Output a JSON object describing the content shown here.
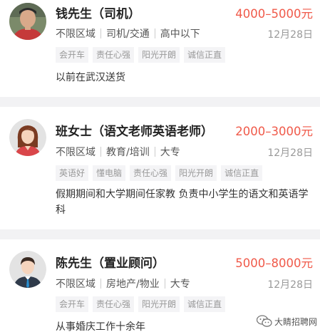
{
  "listings": [
    {
      "name": "钱先生（司机）",
      "salary": "4000–5000元",
      "meta": [
        "不限区域",
        "司机/交通",
        "高中以下"
      ],
      "date": "12月28日",
      "tags": [
        "会开车",
        "责任心强",
        "阳光开朗",
        "诚信正直"
      ],
      "description": "以前在武汉送货",
      "avatar": "photo-avatar"
    },
    {
      "name": "班女士（语文老师英语老师）",
      "salary": "2000–3000元",
      "meta": [
        "不限区域",
        "教育/培训",
        "大专"
      ],
      "date": "12月28日",
      "tags": [
        "英语好",
        "懂电脑",
        "责任心强",
        "阳光开朗",
        "诚信正直"
      ],
      "description": "假期期间和大学期间任家教 负责中小学生的语文和英语学科",
      "avatar": "female-avatar-icon"
    },
    {
      "name": "陈先生（置业顾问）",
      "salary": "5000–8000元",
      "meta": [
        "不限区域",
        "房地产/物业",
        "大专"
      ],
      "date": "12月28日",
      "tags": [
        "会开车",
        "责任心强",
        "阳光开朗",
        "诚信正直"
      ],
      "description": "从事婚庆工作十余年",
      "avatar": "male-avatar-icon"
    }
  ],
  "watermark": {
    "text": "大睛招聘网",
    "icon": "wechat-icon"
  },
  "colors": {
    "salary": "#f05a4a",
    "background": "#f2f2f4",
    "tag_bg": "#f4f4f6"
  }
}
